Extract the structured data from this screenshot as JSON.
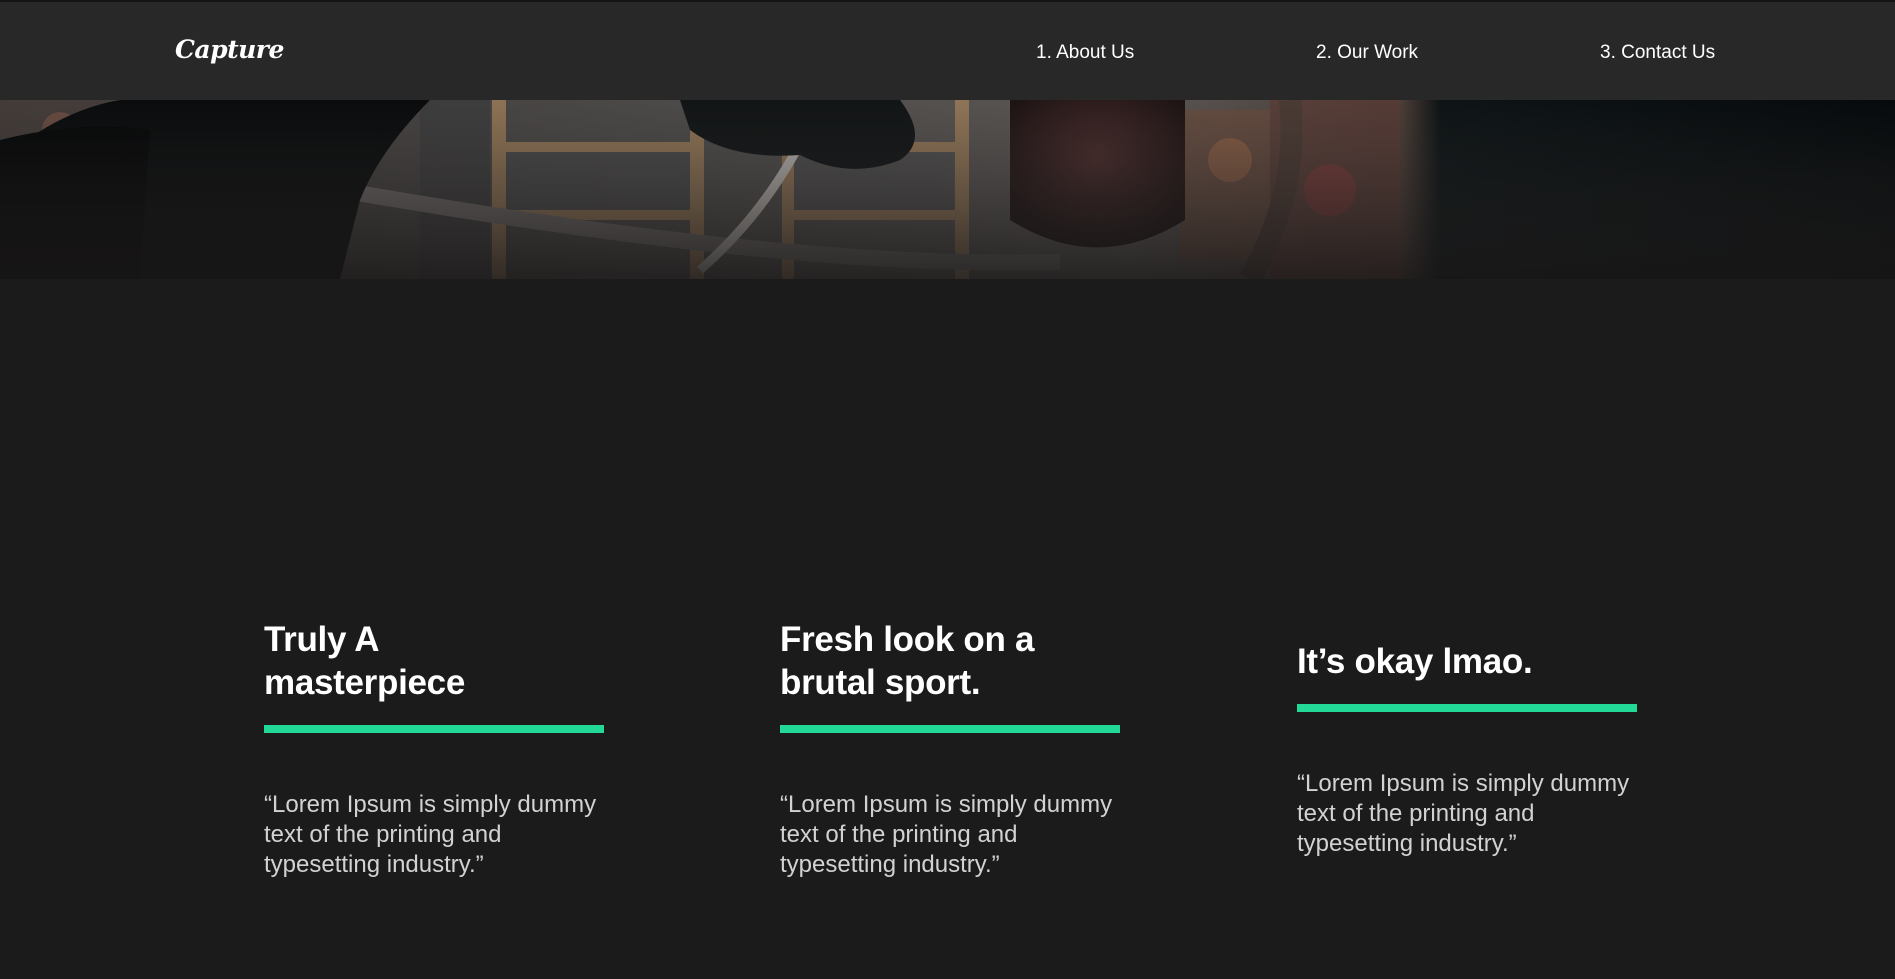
{
  "header": {
    "logo": "Capture",
    "nav": [
      {
        "label": "1. About Us"
      },
      {
        "label": "2. Our Work"
      },
      {
        "label": "3. Contact Us"
      }
    ]
  },
  "hero": {
    "image": "boxing-gym-photo"
  },
  "features": [
    {
      "title_line1": "Truly A",
      "title_line2": "masterpiece",
      "text": "“Lorem Ipsum is simply dummy text of the printing and typesetting industry.”"
    },
    {
      "title_line1": "Fresh look on a",
      "title_line2": "brutal sport.",
      "text": "“Lorem Ipsum is simply dummy text of the printing and typesetting industry.”"
    },
    {
      "title_line1": "It’s okay lmao.",
      "title_line2": "",
      "text": "“Lorem Ipsum is simply dummy text of the printing and typesetting industry.”"
    }
  ],
  "colors": {
    "accent": "#23d997",
    "background": "#1b1b1b",
    "header": "#282828"
  }
}
